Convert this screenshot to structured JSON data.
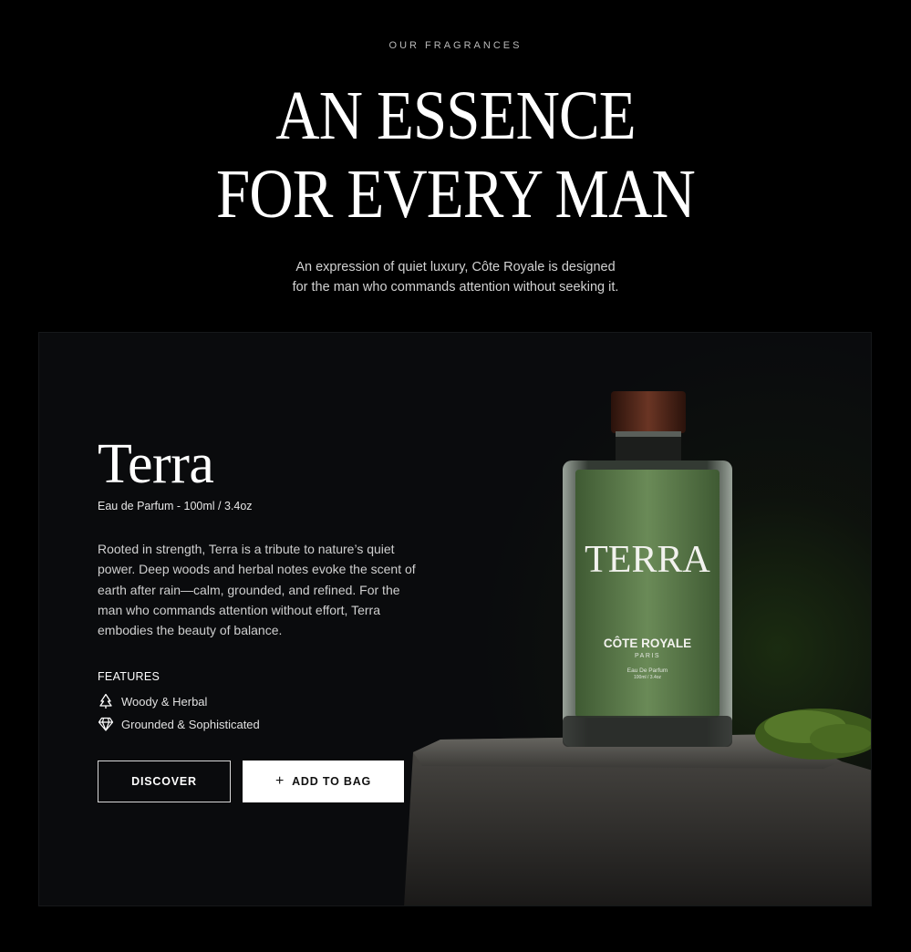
{
  "hero": {
    "eyebrow": "OUR FRAGRANCES",
    "title_line1": "AN ESSENCE",
    "title_line2": "FOR EVERY MAN",
    "intro_line1": "An expression of quiet luxury, Côte Royale is designed",
    "intro_line2": "for the man who commands attention without seeking it."
  },
  "product": {
    "name": "Terra",
    "subtitle": "Eau de Parfum - 100ml / 3.4oz",
    "description": "Rooted in strength, Terra is a tribute to nature’s quiet power. Deep woods and herbal notes evoke the scent of earth after rain—calm, grounded, and refined. For the man who commands attention without effort, Terra embodies the beauty of balance.",
    "features_title": "FEATURES",
    "features": [
      {
        "icon": "tree-icon",
        "label": "Woody & Herbal"
      },
      {
        "icon": "diamond-icon",
        "label": "Grounded & Sophisticated"
      }
    ],
    "discover_label": "DISCOVER",
    "add_to_bag_label": "ADD TO BAG",
    "add_icon": "plus-icon"
  },
  "bottle_label": {
    "name": "TERRA",
    "brand": "CÔTE ROYALE",
    "city": "PARIS",
    "type": "Eau De Parfum",
    "volume": "100ml / 3.4oz"
  },
  "colors": {
    "background": "#000000",
    "card": "#0a0b0d",
    "bottle_liquid": "#5f7d4d",
    "cap": "#4a2418"
  }
}
